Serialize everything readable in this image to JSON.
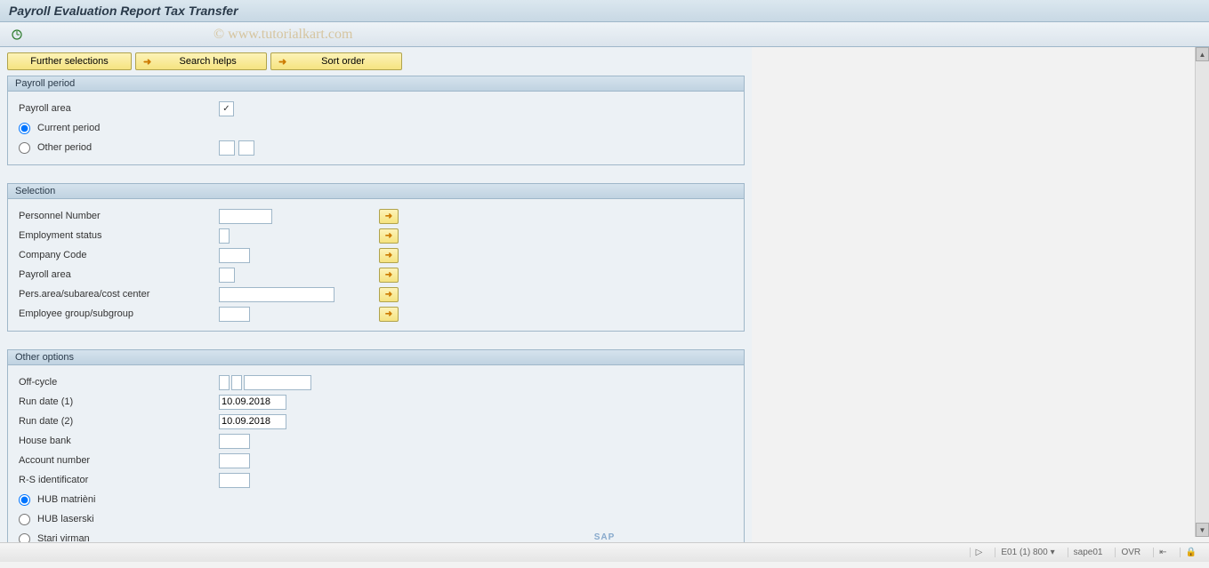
{
  "title": "Payroll Evaluation Report Tax Transfer",
  "watermark": "© www.tutorialkart.com",
  "buttons": {
    "further_selections": "Further selections",
    "search_helps": "Search helps",
    "sort_order": "Sort order"
  },
  "groups": {
    "payroll_period": {
      "title": "Payroll period",
      "payroll_area_label": "Payroll area",
      "payroll_area_checked": true,
      "current_period_label": "Current period",
      "other_period_label": "Other period"
    },
    "selection": {
      "title": "Selection",
      "personnel_number": "Personnel Number",
      "employment_status": "Employment status",
      "company_code": "Company Code",
      "payroll_area": "Payroll area",
      "pers_area": "Pers.area/subarea/cost center",
      "employee_group": "Employee group/subgroup"
    },
    "other_options": {
      "title": "Other options",
      "off_cycle": "Off-cycle",
      "run_date_1_label": "Run date (1)",
      "run_date_1_value": "10.09.2018",
      "run_date_2_label": "Run date (2)",
      "run_date_2_value": "10.09.2018",
      "house_bank": "House bank",
      "account_number": "Account number",
      "rs_identificator": "R-S identificator",
      "hub_matricni": "HUB matrièni",
      "hub_laserski": "HUB laserski",
      "stari_virman": "Stari virman"
    }
  },
  "status": {
    "system": "E01 (1) 800",
    "server": "sape01",
    "mode": "OVR"
  }
}
